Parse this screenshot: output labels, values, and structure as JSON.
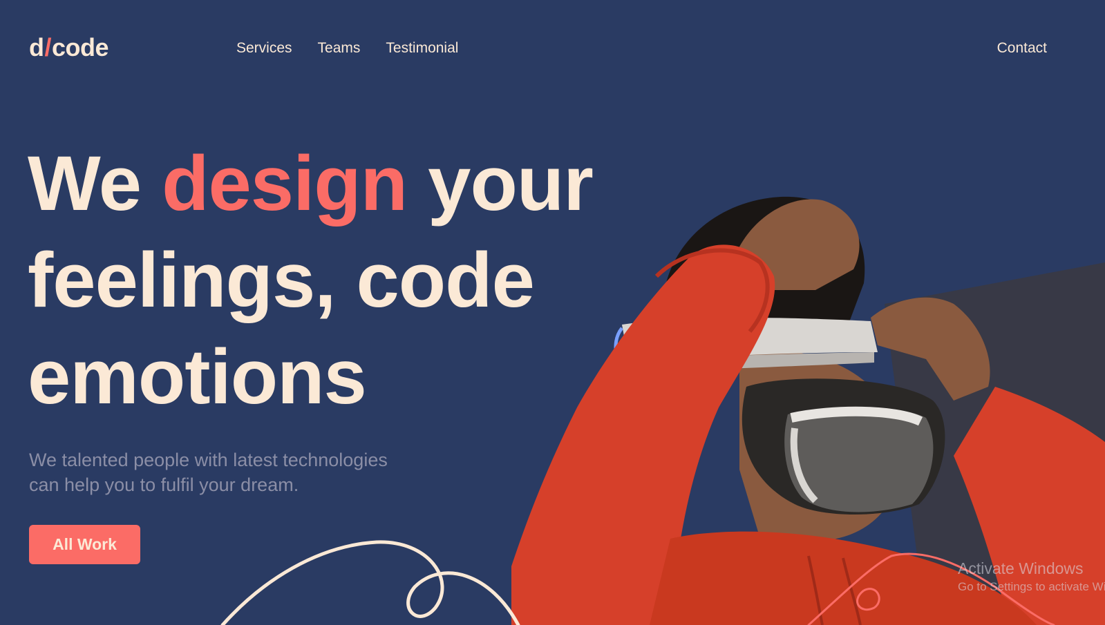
{
  "brand": {
    "logo_left": "d",
    "logo_slash": "/",
    "logo_right": "code"
  },
  "nav": {
    "items": [
      {
        "label": "Services"
      },
      {
        "label": "Teams"
      },
      {
        "label": "Testimonial"
      }
    ],
    "contact_label": "Contact"
  },
  "hero": {
    "headline_part1": "We ",
    "headline_accent": "design",
    "headline_part2": " your",
    "headline_line2": "feelings, code",
    "headline_line3": "emotions",
    "subtext_line1": "We talented people with latest technologies",
    "subtext_line2": "can help you to fulfil your dream.",
    "cta_label": "All Work"
  },
  "watermark": {
    "title": "Activate Windows",
    "subtitle": "Go to Settings to activate Windows."
  },
  "colors": {
    "background": "#2a3b63",
    "text_cream": "#fbe9d6",
    "accent_coral": "#fb6c66",
    "muted_text": "#8b8ea6",
    "hoodie_red": "#d6402a"
  },
  "images": {
    "hero_photo": "person-in-red-hoodie-wearing-vr-headset"
  }
}
